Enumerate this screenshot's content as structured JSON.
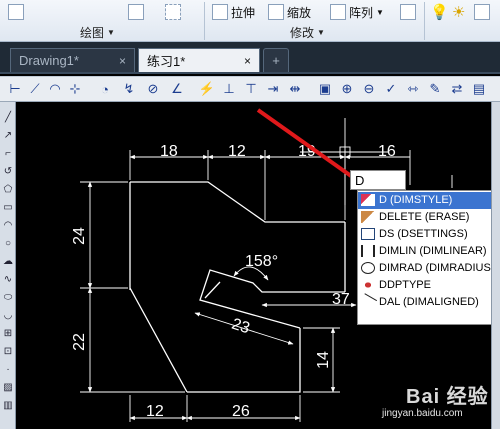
{
  "ribbon": {
    "draw_group_label": "绘图",
    "modify_group_label": "修改",
    "stretch_label": "拉伸",
    "scale_label": "缩放",
    "array_label": "阵列"
  },
  "tabs": [
    {
      "label": "Drawing1*",
      "close": "×"
    },
    {
      "label": "练习1*",
      "close": "×"
    }
  ],
  "command": {
    "input_value": "D",
    "suggestions": [
      "D (DIMSTYLE)",
      "DELETE (ERASE)",
      "DS (DSETTINGS)",
      "DIMLIN (DIMLINEAR)",
      "DIMRAD (DIMRADIUS)",
      "DDPTYPE",
      "DAL (DIMALIGNED)"
    ],
    "selected_index": 0
  },
  "drawing": {
    "dims": {
      "top1": "18",
      "top2": "12",
      "top3": "19",
      "top4": "16",
      "left1": "24",
      "left2": "22",
      "angle": "158°",
      "aligned": "23",
      "mid": "37",
      "right": "14",
      "bottom1": "12",
      "bottom2": "26"
    }
  },
  "watermark": {
    "text": "Bai 经验",
    "url": "jingyan.baidu.com"
  },
  "colors": {
    "canvas_bg": "#000000",
    "geometry": "#ffffff",
    "arrow": "#e0191b",
    "selection": "#3b74d0"
  }
}
